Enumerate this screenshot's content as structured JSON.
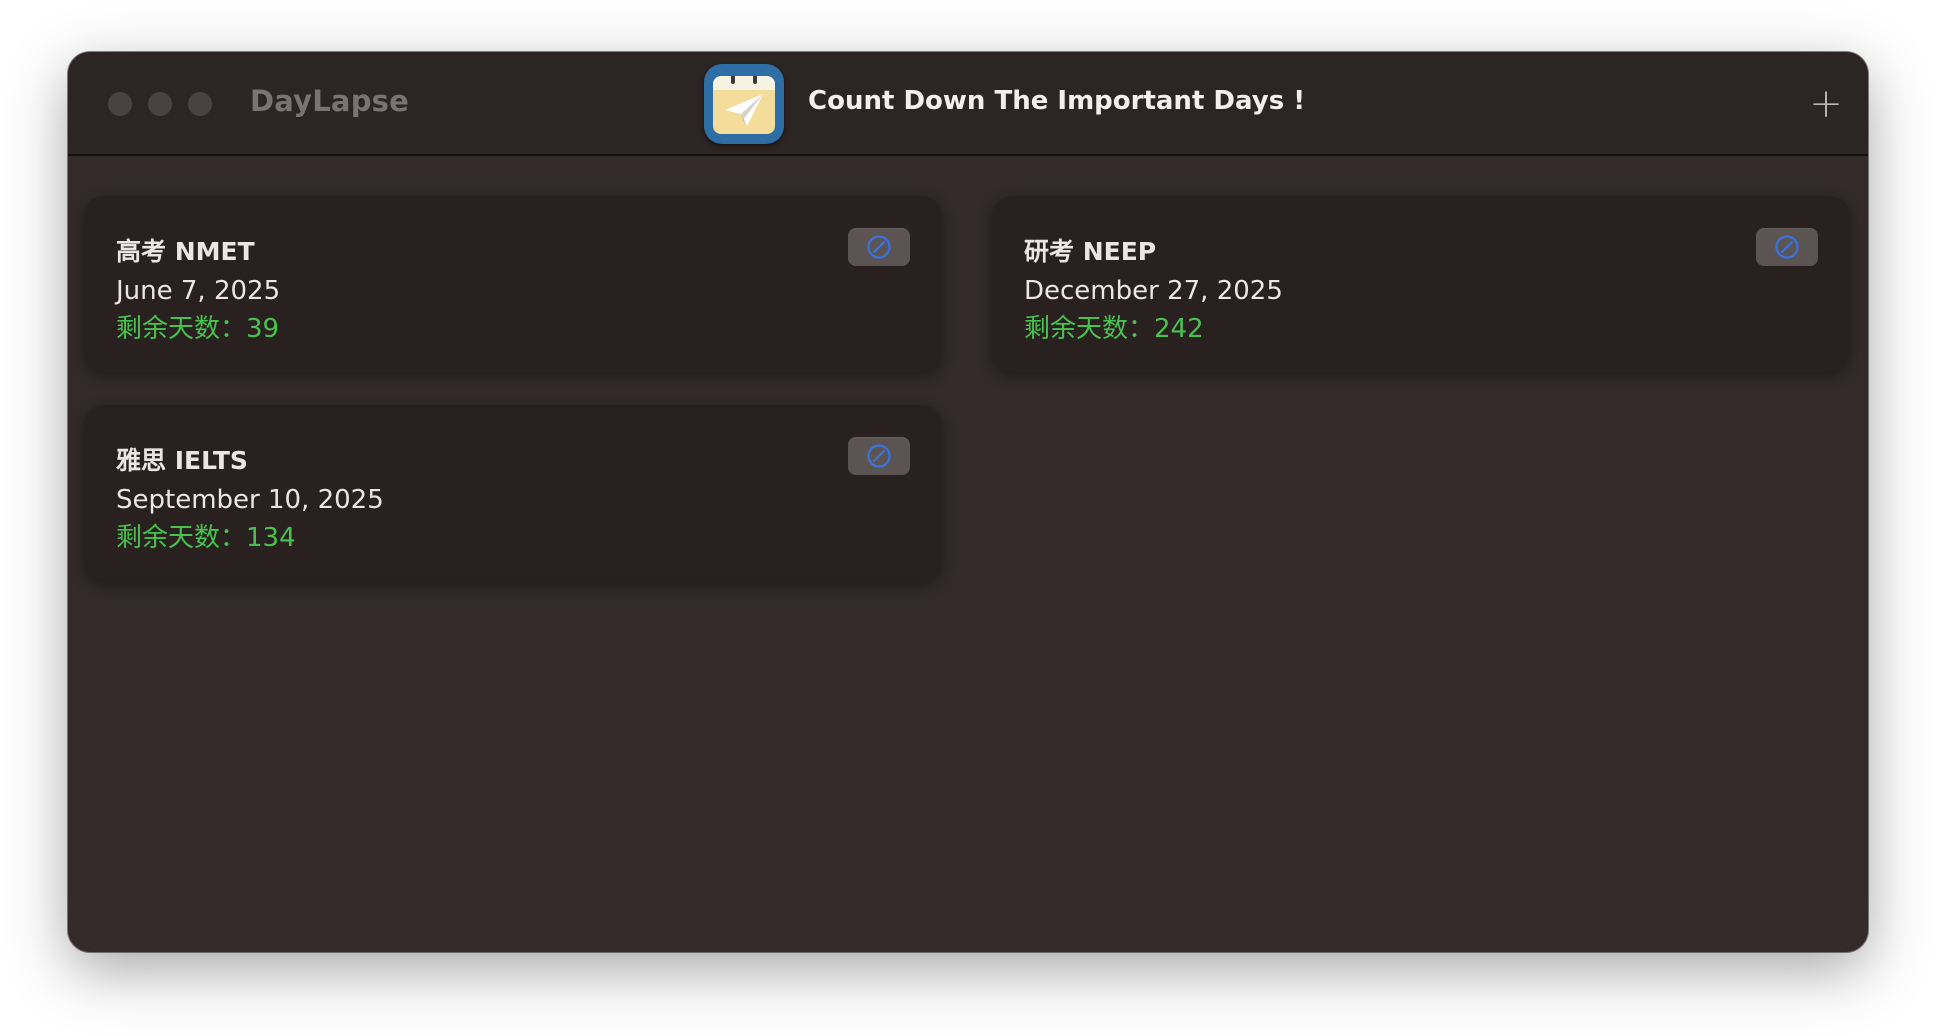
{
  "window": {
    "app_name": "DayLapse",
    "title": "Count Down The Important Days !",
    "add_button_label": "+"
  },
  "countdowns": [
    {
      "name": "高考 NMET",
      "date": "June 7, 2025",
      "remaining_label": "剩余天数：",
      "remaining_days": "39"
    },
    {
      "name": "研考 NEEP",
      "date": "December 27, 2025",
      "remaining_label": "剩余天数：",
      "remaining_days": "242"
    },
    {
      "name": "雅思 IELTS",
      "date": "September 10, 2025",
      "remaining_label": "剩余天数：",
      "remaining_days": "134"
    }
  ],
  "icons": {
    "delete": "prohibit-icon",
    "add": "plus-icon",
    "app": "calendar-paper-plane-icon"
  },
  "colors": {
    "window_bg": "#332a29",
    "card_bg": "#292120",
    "remaining_text": "#48c24e",
    "icon_accent": "#3a73e0"
  }
}
